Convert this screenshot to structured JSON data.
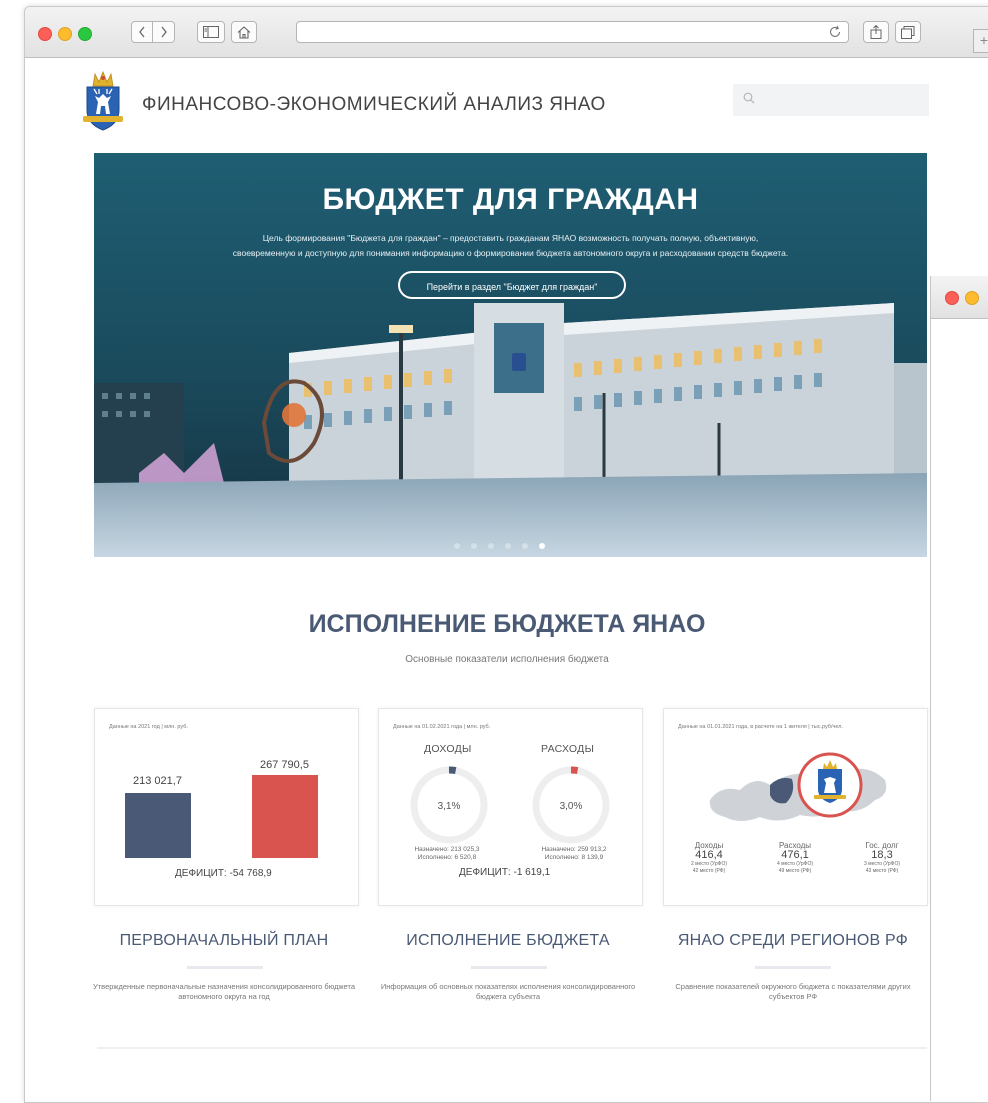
{
  "site": {
    "title": "ФИНАНСОВО-ЭКОНОМИЧЕСКИЙ АНАЛИЗ ЯНАО",
    "search_icon": "search-icon"
  },
  "hero": {
    "title": "БЮДЖЕТ ДЛЯ ГРАЖДАН",
    "desc_line1": "Цель формирования \"Бюджета для граждан\" – предоставить гражданам ЯНАО возможность получать полную, объективную,",
    "desc_line2": "своевременную и доступную для понимания информацию о формировании бюджета автономного округа и расходовании средств бюджета.",
    "button": "Перейти в раздел \"Бюджет для граждан\"",
    "slides": 6,
    "active_slide": 6
  },
  "section": {
    "title": "ИСПОЛНЕНИЕ БЮДЖЕТА ЯНАО",
    "subtitle": "Основные показатели исполнения бюджета"
  },
  "card1": {
    "note": "Данные на 2021 год | млн. руб.",
    "income_value": "213 021,7",
    "expense_value": "267 790,5",
    "deficit": "ДЕФИЦИТ: -54 768,9",
    "colors": {
      "income": "#4a5a76",
      "expense": "#d9534f"
    }
  },
  "card2": {
    "note": "Данные на 01.02.2021 года | млн. руб.",
    "income_label": "ДОХОДЫ",
    "expense_label": "РАСХОДЫ",
    "income_pct": "3,1%",
    "expense_pct": "3,0%",
    "income_planned": "Назначено: 213 025,3",
    "income_done": "Исполнено: 6 520,8",
    "expense_planned": "Назначено: 259 913,2",
    "expense_done": "Исполнено: 8 139,9",
    "deficit": "ДЕФИЦИТ: -1 619,1"
  },
  "card3": {
    "note": "Данные на 01.01.2021 года, в расчете на 1 жителя | тыс.руб/чел.",
    "income_label": "Доходы",
    "income_value": "416,4",
    "income_rank1": "2 место (УрФО)",
    "income_rank2": "42 место (РФ)",
    "expense_label": "Расходы",
    "expense_value": "476,1",
    "expense_rank1": "4 место (УрФО)",
    "expense_rank2": "49 место (РФ)",
    "debt_label": "Гос. долг",
    "debt_value": "18,3",
    "debt_rank1": "3 место (УрФО)",
    "debt_rank2": "43 место (РФ)"
  },
  "columns": [
    {
      "title": "ПЕРВОНАЧАЛЬНЫЙ ПЛАН",
      "desc": "Утвержденные первоначальные назначения консолидированного бюджета автономного округа на год"
    },
    {
      "title": "ИСПОЛНЕНИЕ БЮДЖЕТА",
      "desc": "Информация об основных показателях исполнения консолидированного бюджета субъекта"
    },
    {
      "title": "ЯНАО СРЕДИ РЕГИОНОВ РФ",
      "desc": "Сравнение показателей окружного бюджета с показателями других субъектов РФ"
    }
  ]
}
